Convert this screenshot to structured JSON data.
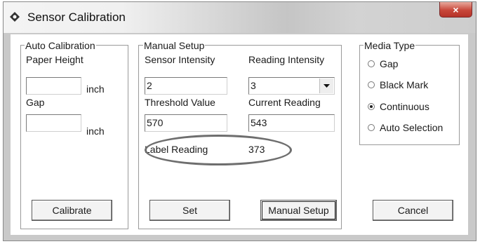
{
  "window": {
    "title": "Sensor Calibration",
    "close_glyph": "×"
  },
  "auto_calibration": {
    "group_label": "Auto Calibration",
    "paper_height_label": "Paper Height",
    "paper_height_value": "",
    "paper_height_unit": "inch",
    "gap_label": "Gap",
    "gap_value": "",
    "gap_unit": "inch",
    "calibrate_button": "Calibrate"
  },
  "manual_setup": {
    "group_label": "Manual Setup",
    "sensor_intensity_label": "Sensor Intensity",
    "sensor_intensity_value": "2",
    "reading_intensity_label": "Reading Intensity",
    "reading_intensity_value": "3",
    "threshold_label": "Threshold Value",
    "threshold_value": "570",
    "current_reading_label": "Current Reading",
    "current_reading_value": "543",
    "label_reading_label": "Label Reading",
    "label_reading_value": "373",
    "set_button": "Set",
    "manual_setup_button": "Manual Setup"
  },
  "media_type": {
    "group_label": "Media Type",
    "options": [
      {
        "label": "Gap",
        "selected": false
      },
      {
        "label": "Black Mark",
        "selected": false
      },
      {
        "label": "Continuous",
        "selected": true
      },
      {
        "label": "Auto Selection",
        "selected": false
      }
    ],
    "cancel_button": "Cancel"
  },
  "icons": {
    "app": "app-icon",
    "close": "close-icon",
    "dropdown": "chevron-down-icon"
  },
  "colors": {
    "close_button": "#c8473a",
    "annotation_ellipse": "#6e6e6e"
  }
}
